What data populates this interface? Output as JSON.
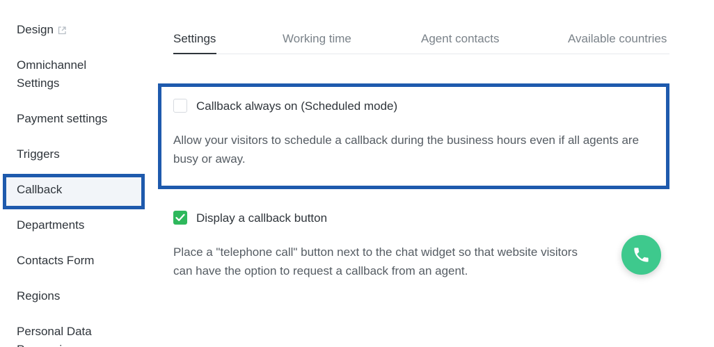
{
  "sidebar": {
    "items": [
      {
        "label": "Design",
        "external": true
      },
      {
        "label": "Omnichannel",
        "label2": "Settings"
      },
      {
        "label": "Payment settings"
      },
      {
        "label": "Triggers"
      },
      {
        "label": "Callback",
        "active": true
      },
      {
        "label": "Departments"
      },
      {
        "label": "Contacts Form"
      },
      {
        "label": "Regions"
      },
      {
        "label": "Personal Data",
        "label2": "Processing"
      }
    ]
  },
  "tabs": [
    {
      "label": "Settings",
      "active": true
    },
    {
      "label": "Working time"
    },
    {
      "label": "Agent contacts"
    },
    {
      "label": "Available countries"
    }
  ],
  "options": [
    {
      "title": "Callback always on (Scheduled mode)",
      "checked": false,
      "desc_line1": "Allow your visitors to schedule a callback during the business hours even if all agents are",
      "desc_line2": "busy or away."
    },
    {
      "title": "Display a callback button",
      "checked": true,
      "desc_line1": "Place a \"telephone call\" button next to the chat widget so that website visitors",
      "desc_line2": "can have the option to request a callback from an agent."
    }
  ],
  "colors": {
    "highlight": "#1e5aad",
    "checkbox_on": "#2eb85c",
    "fab": "#3ec98d"
  },
  "icons": {
    "external": "external-link-icon",
    "check": "checkmark-icon",
    "fab": "phone-icon"
  }
}
